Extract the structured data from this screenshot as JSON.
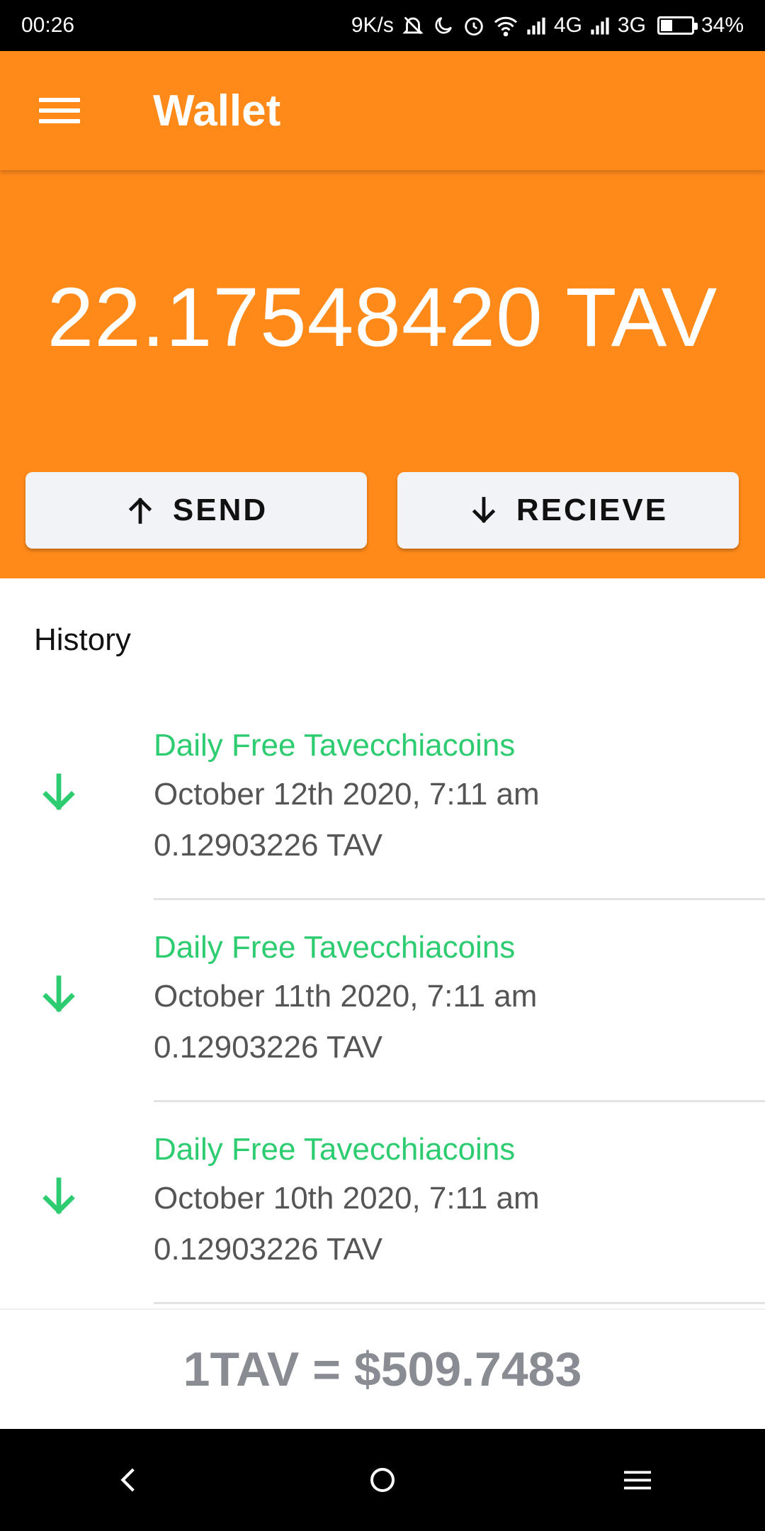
{
  "status": {
    "time": "00:26",
    "speed": "9K/s",
    "net1": "4G",
    "net2": "3G",
    "battery": "34%"
  },
  "appbar": {
    "title": "Wallet"
  },
  "balance": {
    "text": "22.17548420 TAV"
  },
  "actions": {
    "send": "SEND",
    "receive": "RECIEVE"
  },
  "history": {
    "title": "History",
    "items": [
      {
        "title": "Daily Free Tavecchiacoins",
        "date": "October 12th 2020, 7:11 am",
        "amount": "0.12903226 TAV"
      },
      {
        "title": "Daily Free Tavecchiacoins",
        "date": "October 11th 2020, 7:11 am",
        "amount": "0.12903226 TAV"
      },
      {
        "title": "Daily Free Tavecchiacoins",
        "date": "October 10th 2020, 7:11 am",
        "amount": "0.12903226 TAV"
      }
    ]
  },
  "rate": {
    "text": "1TAV = $509.7483"
  },
  "colors": {
    "accent": "#ff8a1a",
    "incoming": "#2ecc71"
  }
}
